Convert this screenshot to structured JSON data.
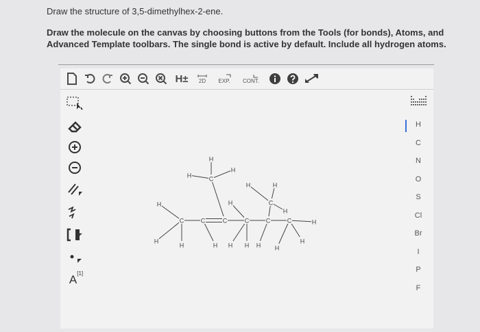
{
  "question": {
    "text": "Draw the structure of 3,5-dimethylhex-2-ene."
  },
  "instruction": {
    "text": "Draw the molecule on the canvas by choosing buttons from the Tools (for bonds), Atoms, and Advanced Template toolbars. The single bond is active by default. Include all hydrogen atoms."
  },
  "toolbar": {
    "hydrogen_label": "H±",
    "twod_label": "2D",
    "exp_label": "EXP.",
    "cont_label": "CONT."
  },
  "lefttools": {
    "atom_map_label": "A",
    "atom_map_sup": "[1]"
  },
  "atoms": [
    "H",
    "C",
    "N",
    "O",
    "S",
    "Cl",
    "Br",
    "I",
    "P",
    "F"
  ],
  "molecule": {
    "carbon_label": "C",
    "hydrogen_label": "H"
  }
}
